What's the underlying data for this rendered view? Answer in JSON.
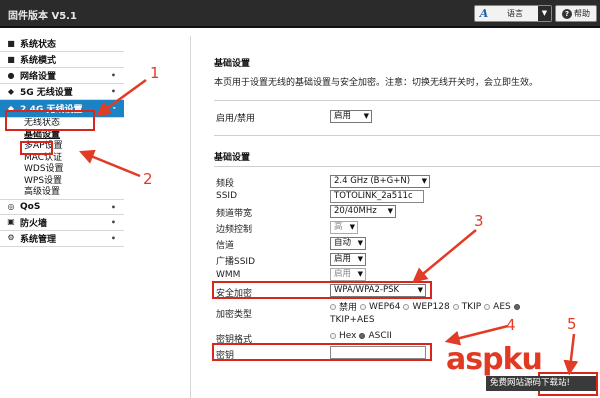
{
  "header": {
    "firmware": "固件版本 V5.1",
    "language_icon": "A",
    "language_label": "语言",
    "help_label": "帮助"
  },
  "sidebar": {
    "items": [
      {
        "label": "系统状态",
        "icon": "square-icon"
      },
      {
        "label": "系统模式",
        "icon": "square-icon"
      },
      {
        "label": "网络设置",
        "icon": "globe-icon"
      },
      {
        "label": "5G 无线设置",
        "icon": "wifi-icon"
      },
      {
        "label": "2.4G 无线设置",
        "icon": "wifi-icon"
      }
    ],
    "sub_items": [
      "无线状态",
      "基础设置",
      "多AP设置",
      "MAC认证",
      "WDS设置",
      "WPS设置",
      "高级设置"
    ],
    "bottom_items": [
      {
        "label": "QoS",
        "icon": "qos-icon"
      },
      {
        "label": "防火墙",
        "icon": "firewall-icon"
      },
      {
        "label": "系统管理",
        "icon": "gear-icon"
      }
    ],
    "dot": "•",
    "active_dot": "-"
  },
  "main": {
    "section1_title": "基础设置",
    "description": "本页用于设置无线的基础设置与安全加密。注意：切换无线开关时，会立即生效。",
    "enable_label": "启用/禁用",
    "enable_value": "启用",
    "section2_title": "基础设置",
    "fields": {
      "band_label": "频段",
      "band_value": "2.4 GHz (B+G+N)",
      "ssid_label": "SSID",
      "ssid_value": "TOTOLINK_2a511c",
      "bandwidth_label": "频道带宽",
      "bandwidth_value": "20/40MHz",
      "sideband_label": "边频控制",
      "sideband_value": "高",
      "channel_label": "信道",
      "channel_value": "自动",
      "broadcast_label": "广播SSID",
      "broadcast_value": "启用",
      "wmm_label": "WMM",
      "wmm_value": "启用",
      "security_label": "安全加密",
      "security_value": "WPA/WPA2-PSK",
      "encryption_label": "加密类型",
      "encryption_options": [
        "禁用",
        "WEP64",
        "WEP128",
        "TKIP",
        "AES"
      ],
      "encryption_selected": "AES",
      "encryption_extra": "TKIP+AES",
      "keyformat_label": "密钥格式",
      "keyformat_options": [
        "Hex",
        "ASCII"
      ],
      "keyformat_selected": "ASCII",
      "key_label": "密钥",
      "key_value": ""
    }
  },
  "annotations": [
    "1",
    "2",
    "3",
    "4",
    "5"
  ],
  "watermark": {
    "brand": "aspku",
    "tagline": "免费网站源码下载站!"
  },
  "colors": {
    "topbar": "#2b2b2b",
    "active_menu": "#1b83c4",
    "annotation_red": "#d9261c"
  }
}
